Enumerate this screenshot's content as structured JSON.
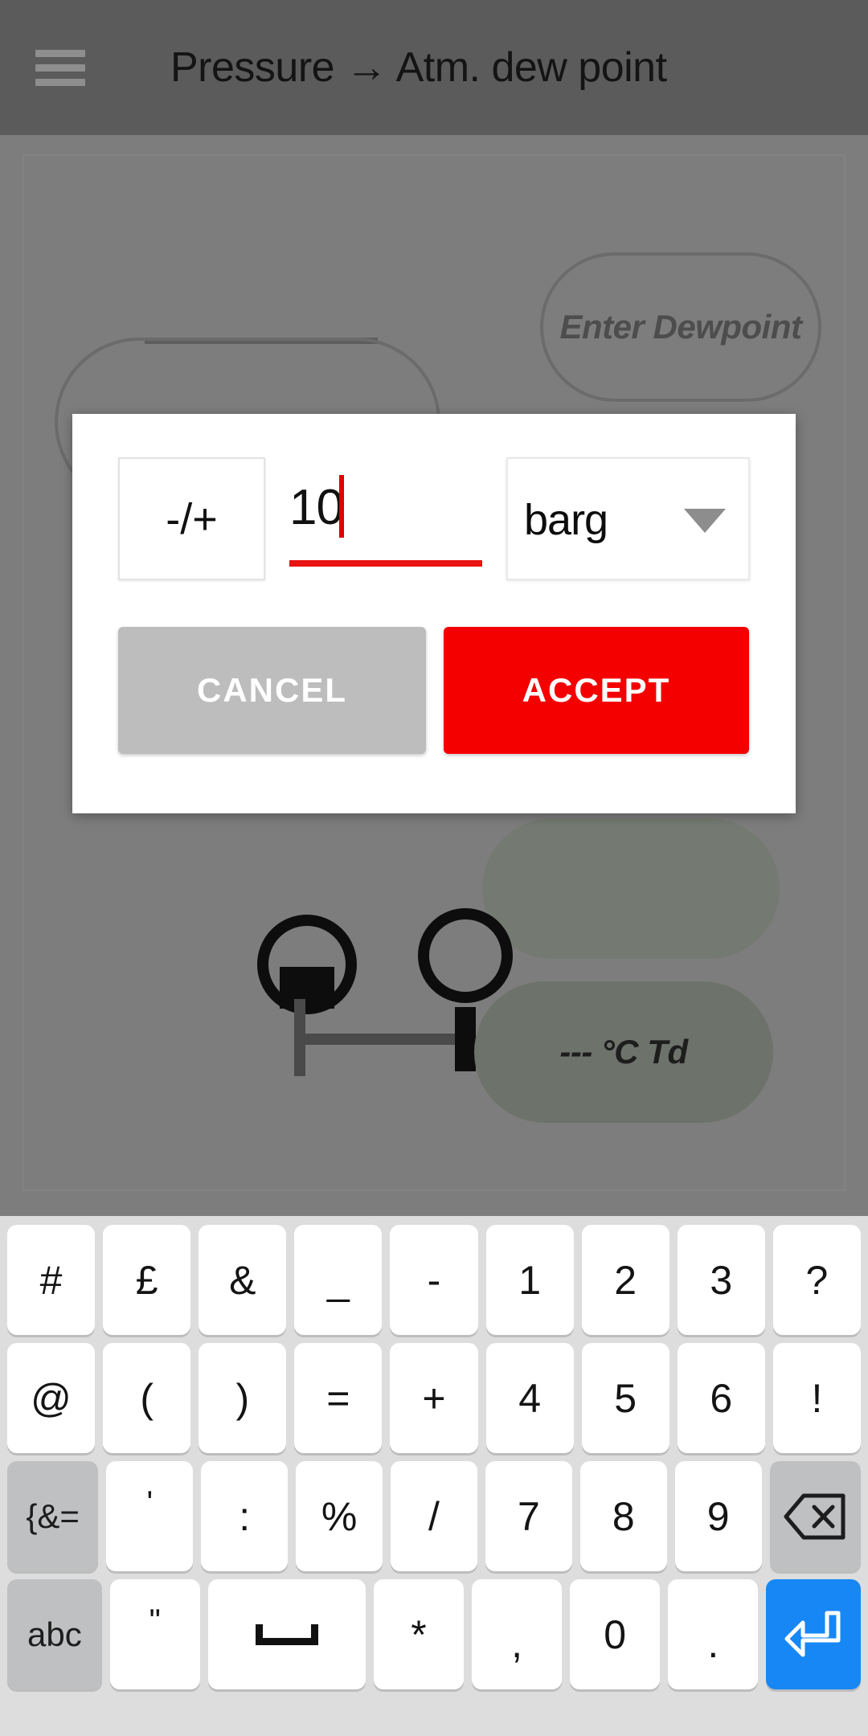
{
  "app_bar": {
    "menu_icon": "hamburger-menu-icon",
    "title": "Pressure → Atm. dew point"
  },
  "background": {
    "dewpoint_pill_label": "Enter Dewpoint",
    "td_readout_label": "--- °C Td",
    "sensor_pill_label": ""
  },
  "dialog": {
    "sign_button_label": "-/+",
    "value": "10",
    "value_placeholder": "0",
    "unit_selected": "barg",
    "unit_caret_icon": "chevron-down-icon",
    "cancel_label": "CANCEL",
    "accept_label": "ACCEPT",
    "accent_color": "#f50000",
    "cancel_color": "#bdbdbd",
    "underline_color": "#e81313"
  },
  "keyboard": {
    "rows": [
      [
        {
          "label": "#",
          "type": "char"
        },
        {
          "label": "£",
          "type": "char"
        },
        {
          "label": "&",
          "type": "char"
        },
        {
          "label": "_",
          "type": "char"
        },
        {
          "label": "-",
          "type": "char"
        },
        {
          "label": "1",
          "type": "char"
        },
        {
          "label": "2",
          "type": "char"
        },
        {
          "label": "3",
          "type": "char"
        },
        {
          "label": "?",
          "type": "char"
        }
      ],
      [
        {
          "label": "@",
          "type": "char"
        },
        {
          "label": "(",
          "type": "char"
        },
        {
          "label": ")",
          "type": "char"
        },
        {
          "label": "=",
          "type": "char"
        },
        {
          "label": "+",
          "type": "char"
        },
        {
          "label": "4",
          "type": "char"
        },
        {
          "label": "5",
          "type": "char"
        },
        {
          "label": "6",
          "type": "char"
        },
        {
          "label": "!",
          "type": "char"
        }
      ],
      [
        {
          "label": "{&=",
          "type": "mod",
          "name": "symbols-toggle-key"
        },
        {
          "label": "'",
          "type": "char"
        },
        {
          "label": ":",
          "type": "char"
        },
        {
          "label": "%",
          "type": "char"
        },
        {
          "label": "/",
          "type": "char"
        },
        {
          "label": "7",
          "type": "char"
        },
        {
          "label": "8",
          "type": "char"
        },
        {
          "label": "9",
          "type": "char"
        },
        {
          "label": "",
          "type": "backspace",
          "name": "backspace-key"
        }
      ],
      [
        {
          "label": "abc",
          "type": "mod",
          "name": "alpha-toggle-key"
        },
        {
          "label": "\"",
          "type": "char"
        },
        {
          "label": "",
          "type": "space",
          "name": "spacebar-key"
        },
        {
          "label": "*",
          "type": "char"
        },
        {
          "label": ",",
          "type": "char"
        },
        {
          "label": "0",
          "type": "char"
        },
        {
          "label": ".",
          "type": "char"
        },
        {
          "label": "",
          "type": "enter",
          "name": "enter-key"
        }
      ]
    ],
    "enter_icon": "enter-return-icon",
    "backspace_icon": "backspace-icon",
    "space_icon": "spacebar-icon",
    "enter_color": "#1787f5",
    "mod_key_color": "#bfc0c2"
  }
}
